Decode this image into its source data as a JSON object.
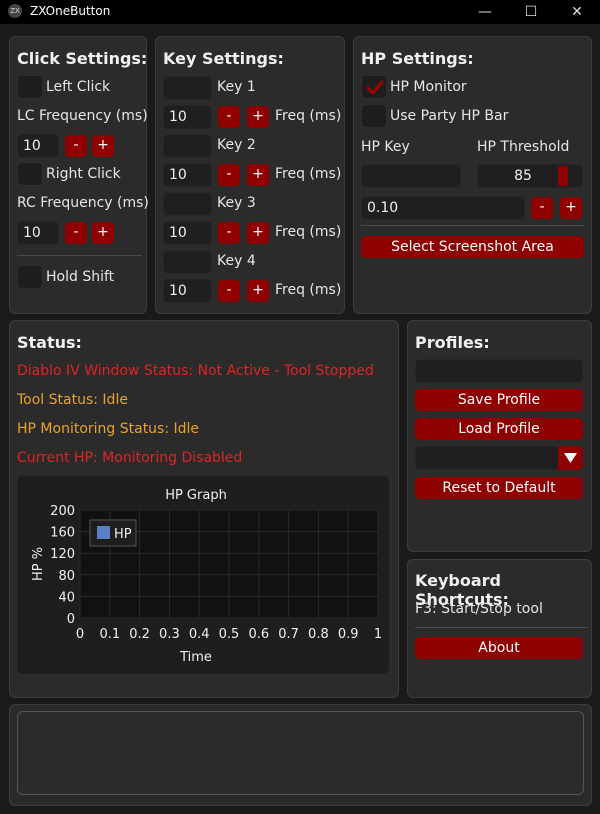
{
  "window": {
    "icon": "ZX",
    "title": "ZXOneButton",
    "minimize": "—",
    "maximize": "☐",
    "close": "✕"
  },
  "click": {
    "title": "Click Settings:",
    "left_click": "Left Click",
    "lc_freq_label": "LC Frequency (ms)",
    "lc_freq": "10",
    "right_click": "Right Click",
    "rc_freq_label": "RC Frequency (ms)",
    "rc_freq": "10",
    "hold_shift": "Hold Shift",
    "minus": "-",
    "plus": "+"
  },
  "keys": {
    "title": "Key Settings:",
    "freq_label": "Freq (ms)",
    "items": [
      {
        "label": "Key 1",
        "key": "",
        "freq": "10"
      },
      {
        "label": "Key 2",
        "key": "",
        "freq": "10"
      },
      {
        "label": "Key 3",
        "key": "",
        "freq": "10"
      },
      {
        "label": "Key 4",
        "key": "",
        "freq": "10"
      }
    ]
  },
  "hp": {
    "title": "HP Settings:",
    "monitor": "HP Monitor",
    "monitor_checked": true,
    "party_bar": "Use Party HP Bar",
    "key_label": "HP Key",
    "key_value": "",
    "threshold_label": "HP Threshold",
    "threshold": "85",
    "threshold_fill": 0.85,
    "step_value": "0.10",
    "screenshot_button": "Select Screenshot Area"
  },
  "status": {
    "title": "Status:",
    "diablo": "Diablo IV Window Status: Not Active - Tool Stopped",
    "tool": "Tool Status: Idle",
    "hp_monitoring": "HP Monitoring Status: Idle",
    "current_hp": "Current HP: Monitoring Disabled",
    "colors": {
      "error": "#e02424",
      "warning": "#e8a32c"
    }
  },
  "profiles": {
    "title": "Profiles:",
    "name_value": "",
    "save": "Save Profile",
    "load": "Load Profile",
    "selected": "",
    "reset": "Reset to Default"
  },
  "shortcuts": {
    "title": "Keyboard Shortcuts:",
    "f3": "F3: Start/Stop tool",
    "about": "About"
  },
  "log": {
    "text": ""
  },
  "chart_data": {
    "type": "line",
    "title": "HP Graph",
    "xlabel": "Time",
    "ylabel": "HP %",
    "xlim": [
      0,
      1
    ],
    "ylim": [
      0,
      200
    ],
    "x_ticks": [
      "0",
      "0.1",
      "0.2",
      "0.3",
      "0.4",
      "0.5",
      "0.6",
      "0.7",
      "0.8",
      "0.9",
      "1"
    ],
    "y_ticks": [
      "0",
      "40",
      "80",
      "120",
      "160",
      "200"
    ],
    "series": [
      {
        "name": "HP",
        "color": "#5b7fc4",
        "x": [],
        "y": []
      }
    ],
    "legend": "top-left",
    "grid": true
  }
}
